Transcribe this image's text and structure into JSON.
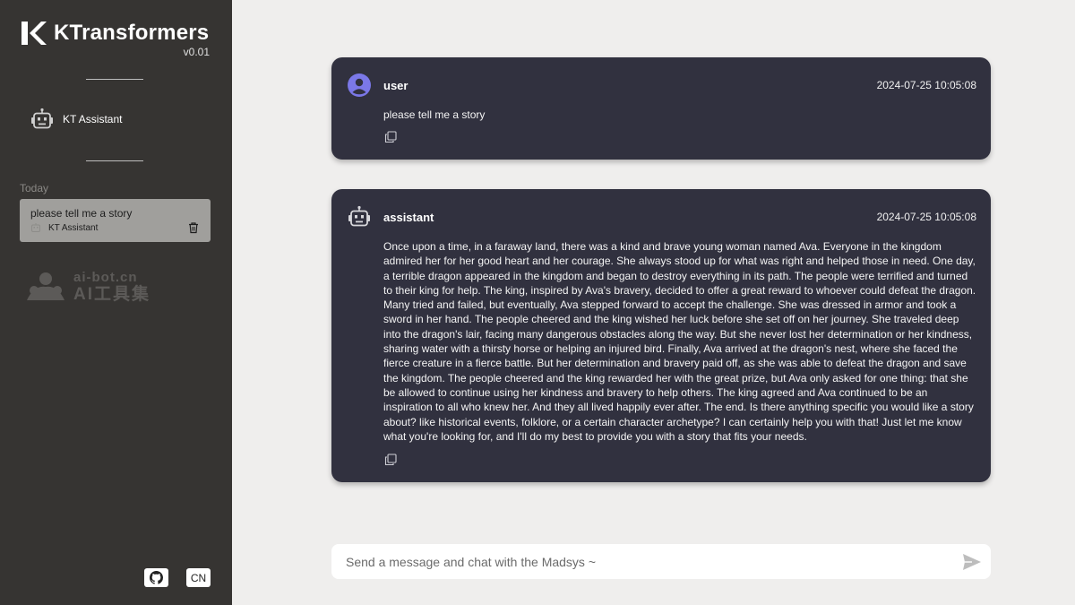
{
  "app": {
    "brand": "KTransformers",
    "version": "v0.01"
  },
  "sidebar": {
    "assistant_label": "KT Assistant",
    "history_group_label": "Today",
    "history": [
      {
        "title": "please tell me a story",
        "assistant": "KT Assistant"
      }
    ],
    "watermark": {
      "line1": "ai-bot.cn",
      "line2": "AI工具集"
    },
    "footer": {
      "github_icon": "github-icon",
      "lang_label": "CN"
    }
  },
  "messages": [
    {
      "role": "user",
      "time": "2024-07-25 10:05:08",
      "text": "please tell me a story"
    },
    {
      "role": "assistant",
      "time": "2024-07-25 10:05:08",
      "text": "Once upon a time, in a faraway land, there was a kind and brave young woman named Ava. Everyone in the kingdom admired her for her good heart and her courage. She always stood up for what was right and helped those in need. One day, a terrible dragon appeared in the kingdom and began to destroy everything in its path. The people were terrified and turned to their king for help. The king, inspired by Ava's bravery, decided to offer a great reward to whoever could defeat the dragon. Many tried and failed, but eventually, Ava stepped forward to accept the challenge. She was dressed in armor and took a sword in her hand. The people cheered and the king wished her luck before she set off on her journey. She traveled deep into the dragon's lair, facing many dangerous obstacles along the way. But she never lost her determination or her kindness, sharing water with a thirsty horse or helping an injured bird. Finally, Ava arrived at the dragon's nest, where she faced the fierce creature in a fierce battle. But her determination and bravery paid off, as she was able to defeat the dragon and save the kingdom. The people cheered and the king rewarded her with the great prize, but Ava only asked for one thing: that she be allowed to continue using her kindness and bravery to help others. The king agreed and Ava continued to be an inspiration to all who knew her. And they all lived happily ever after. The end. Is there anything specific you would like a story about? like historical events, folklore, or a certain character archetype? I can certainly help you with that! Just let me know what you're looking for, and I'll do my best to provide you with a story that fits your needs."
    }
  ],
  "input": {
    "placeholder": "Send a message and chat with the Madsys ~",
    "value": ""
  },
  "colors": {
    "sidebar_bg": "#363432",
    "main_bg": "#efeeed",
    "message_bg": "#31313f",
    "user_avatar": "#7b78e8",
    "history_bg": "#a09f9c"
  }
}
